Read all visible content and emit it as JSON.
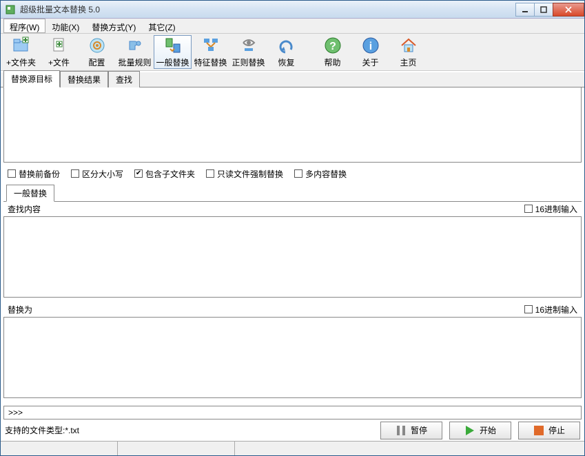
{
  "window": {
    "title": "超级批量文本替换 5.0"
  },
  "menu": {
    "program": "程序(W)",
    "function": "功能(X)",
    "replace_mode": "替换方式(Y)",
    "other": "其它(Z)"
  },
  "toolbar": {
    "add_folder": "+文件夹",
    "add_file": "+文件",
    "config": "配置",
    "batch_rule": "批量规则",
    "normal_replace": "一般替换",
    "feature_replace": "特征替换",
    "regex_replace": "正则替换",
    "restore": "恢复",
    "help": "帮助",
    "about": "关于",
    "home": "主页"
  },
  "tabs": {
    "source": "替换源目标",
    "result": "替换结果",
    "search": "查找"
  },
  "options": {
    "backup": "替换前备份",
    "case_sensitive": "区分大小写",
    "include_subfolders": "包含子文件夹",
    "readonly_force": "只读文件强制替换",
    "multi_content": "多内容替换"
  },
  "subtab": {
    "normal": "一般替换"
  },
  "search_section": {
    "label": "查找内容",
    "hex": "16进制输入"
  },
  "replace_section": {
    "label": "替换为",
    "hex": "16进制输入"
  },
  "cmd_prompt": ">>>",
  "buttons": {
    "pause": "暂停",
    "start": "开始",
    "stop": "停止"
  },
  "status": {
    "filetypes": "支持的文件类型:*.txt"
  }
}
